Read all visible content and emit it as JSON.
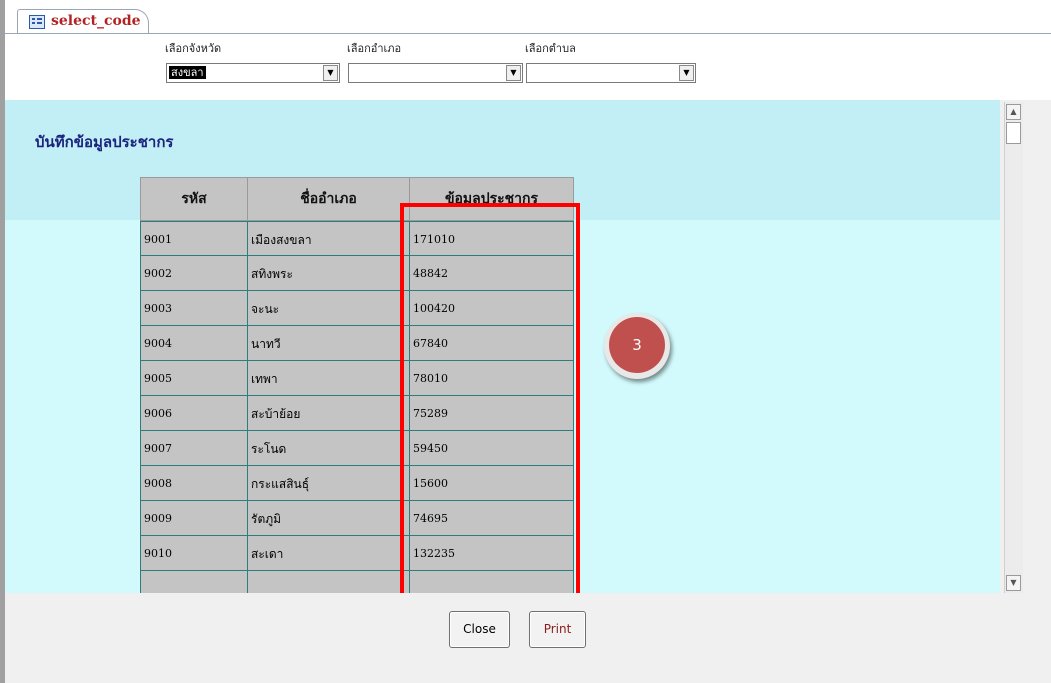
{
  "tab": {
    "label": "select_code",
    "icon": "form-icon"
  },
  "filters": {
    "province": {
      "label": "เลือกจังหวัด",
      "value": "สงขลา"
    },
    "district": {
      "label": "เลือกอำเภอ",
      "value": ""
    },
    "subdistrict": {
      "label": "เลือกตำบล",
      "value": ""
    }
  },
  "section": {
    "title": "บันทึกข้อมูลประชากร"
  },
  "table": {
    "headers": [
      "รหัส",
      "ชื่ออำเภอ",
      "ข้อมูลประชากร"
    ],
    "rows": [
      [
        "9001",
        "เมืองสงขลา",
        "171010"
      ],
      [
        "9002",
        "สทิงพระ",
        "48842"
      ],
      [
        "9003",
        "จะนะ",
        "100420"
      ],
      [
        "9004",
        "นาทวี",
        "67840"
      ],
      [
        "9005",
        "เทพา",
        "78010"
      ],
      [
        "9006",
        "สะบ้าย้อย",
        "75289"
      ],
      [
        "9007",
        "ระโนด",
        "59450"
      ],
      [
        "9008",
        "กระแสสินธุ์",
        "15600"
      ],
      [
        "9009",
        "รัตภูมิ",
        "74695"
      ],
      [
        "9010",
        "สะเดา",
        "132235"
      ],
      [
        "",
        "",
        ""
      ]
    ]
  },
  "annotation": {
    "badge": "3",
    "highlight_color": "#ff0000",
    "badge_color": "#c0504d"
  },
  "buttons": {
    "close": "Close",
    "print": "Print"
  },
  "colors": {
    "detail_bg": "#d2fafc",
    "band_bg": "#c2eef6",
    "title": "#1a237e",
    "print_text": "#8b1a1a"
  }
}
